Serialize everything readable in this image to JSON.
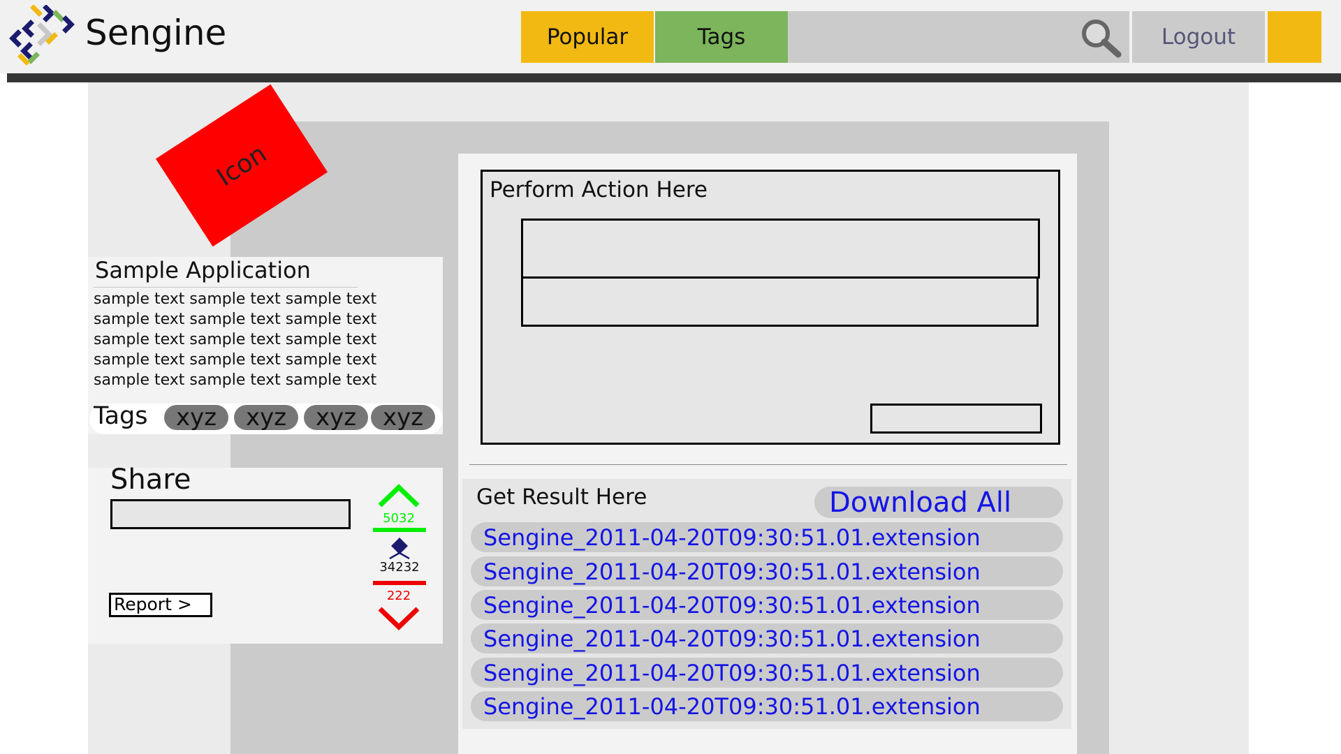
{
  "header": {
    "app_name": "Sengine",
    "nav": {
      "popular_label": "Popular",
      "tags_label": "Tags",
      "logout_label": "Logout"
    },
    "colors": {
      "popular": "#f2b912",
      "tags": "#7cb55b",
      "bar": "#353535"
    },
    "icons": {
      "logo": "sengine-logo-icon",
      "search": "search-icon"
    }
  },
  "sidebar": {
    "icon_label": "Icon",
    "app": {
      "title": "Sample Application",
      "description": "sample text sample text sample text sample text sample text sample text sample text sample text sample text sample text sample text sample text sample text sample text sample text"
    },
    "tags_label": "Tags",
    "tags": [
      "xyz",
      "xyz",
      "xyz",
      "xyz"
    ],
    "share": {
      "title": "Share",
      "input_value": "",
      "report_label": "Report >"
    },
    "votes": {
      "up": "5032",
      "score": "34232",
      "down": "222"
    }
  },
  "main": {
    "action": {
      "title": "Perform Action Here"
    },
    "results": {
      "title": "Get Result Here",
      "download_all_label": "Download All",
      "files": [
        "Sengine_2011-04-20T09:30:51.01.extension",
        "Sengine_2011-04-20T09:30:51.01.extension",
        "Sengine_2011-04-20T09:30:51.01.extension",
        "Sengine_2011-04-20T09:30:51.01.extension",
        "Sengine_2011-04-20T09:30:51.01.extension",
        "Sengine_2011-04-20T09:30:51.01.extension"
      ]
    }
  }
}
